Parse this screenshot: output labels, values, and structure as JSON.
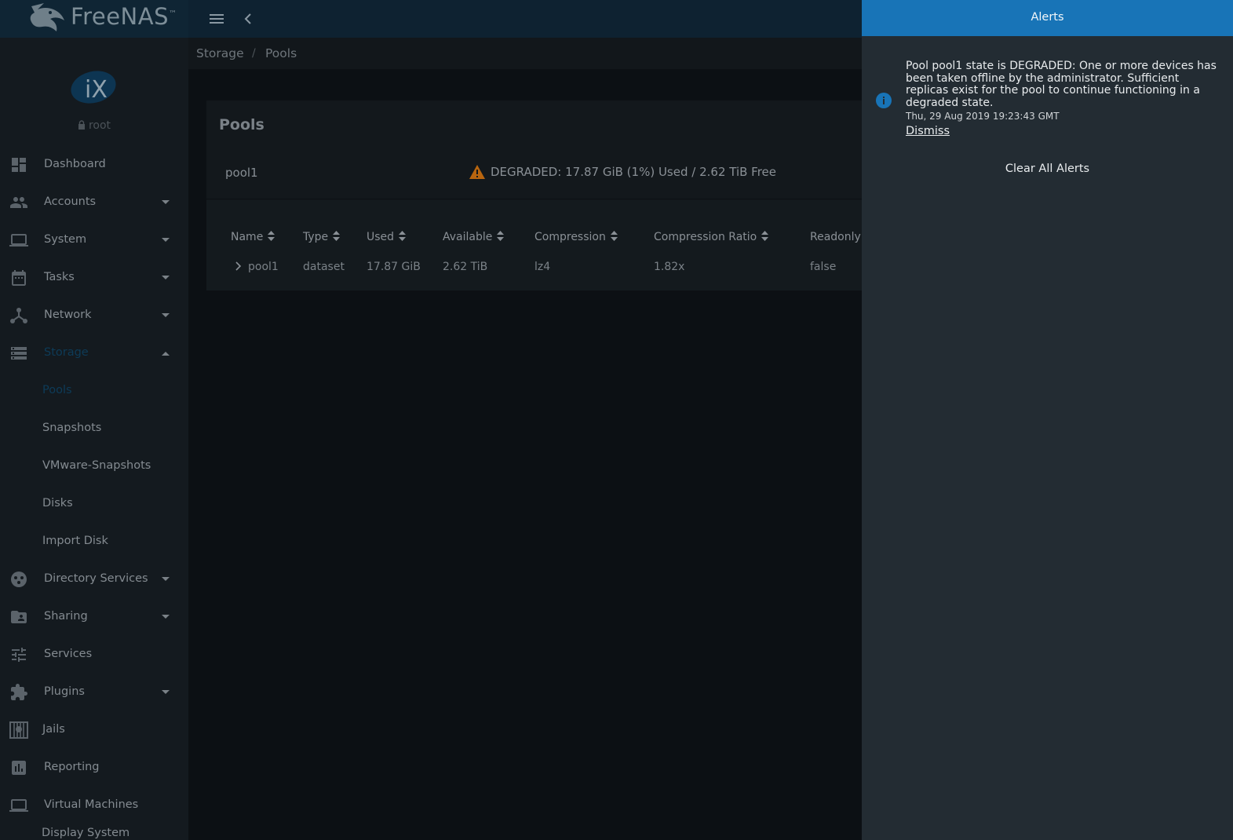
{
  "app": {
    "brand": "FreeNAS",
    "brand_mark": "™"
  },
  "topbar": {
    "menu_icon": "menu-icon",
    "back_icon": "chevron-left-icon"
  },
  "sidebar": {
    "logo": "iX",
    "user": "root",
    "items": [
      {
        "label": "Dashboard",
        "icon": "dashboard-icon"
      },
      {
        "label": "Accounts",
        "icon": "people-icon",
        "caret": "down"
      },
      {
        "label": "System",
        "icon": "laptop-icon",
        "caret": "down"
      },
      {
        "label": "Tasks",
        "icon": "calendar-icon",
        "caret": "down"
      },
      {
        "label": "Network",
        "icon": "network-icon",
        "caret": "down"
      },
      {
        "label": "Storage",
        "icon": "storage-icon",
        "caret": "up",
        "active": true
      },
      {
        "label": "Pools",
        "sub": true,
        "active": true
      },
      {
        "label": "Snapshots",
        "sub": true
      },
      {
        "label": "VMware-Snapshots",
        "sub": true
      },
      {
        "label": "Disks",
        "sub": true
      },
      {
        "label": "Import Disk",
        "sub": true
      },
      {
        "label": "Directory Services",
        "icon": "directory-icon",
        "caret": "down"
      },
      {
        "label": "Sharing",
        "icon": "folder-shared-icon",
        "caret": "down"
      },
      {
        "label": "Services",
        "icon": "tune-icon"
      },
      {
        "label": "Plugins",
        "icon": "puzzle-icon",
        "caret": "down"
      },
      {
        "label": "Jails",
        "icon": "jail-icon"
      },
      {
        "label": "Reporting",
        "icon": "chart-icon"
      },
      {
        "label": "Virtual Machines",
        "icon": "computer-icon"
      },
      {
        "label": "Display System",
        "icon": "arrow-icon"
      }
    ]
  },
  "breadcrumb": {
    "parent": "Storage",
    "separator": "/",
    "current": "Pools"
  },
  "pools_card": {
    "title": "Pools",
    "pool_name": "pool1",
    "status": "DEGRADED: 17.87 GiB (1%) Used / 2.62 TiB Free",
    "status_color": "#b8650f",
    "columns": [
      "Name",
      "Type",
      "Used",
      "Available",
      "Compression",
      "Compression Ratio",
      "Readonly"
    ],
    "rows": [
      [
        "pool1",
        "dataset",
        "17.87 GiB",
        "2.62 TiB",
        "lz4",
        "1.82x",
        "false"
      ]
    ]
  },
  "alerts": {
    "title": "Alerts",
    "accent": "#1874b7",
    "items": [
      {
        "message": "Pool pool1 state is DEGRADED: One or more devices has been taken offline by the administrator. Sufficient replicas exist for the pool to continue functioning in a degraded state.",
        "time": "Thu, 29 Aug 2019 19:23:43 GMT",
        "dismiss": "Dismiss",
        "icon": "info-icon"
      }
    ],
    "clear_all": "Clear All Alerts"
  }
}
